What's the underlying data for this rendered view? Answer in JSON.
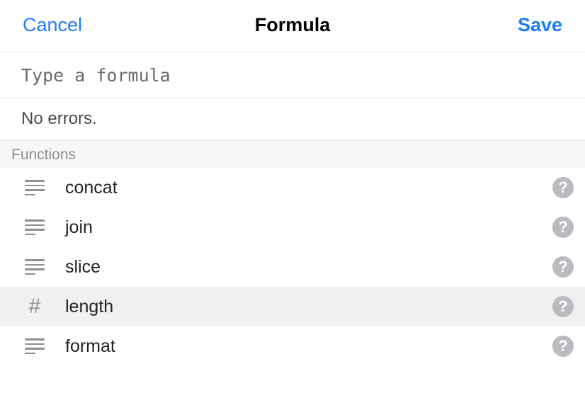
{
  "header": {
    "cancel_label": "Cancel",
    "title": "Formula",
    "save_label": "Save"
  },
  "editor": {
    "placeholder": "Type a formula",
    "value": "",
    "status_text": "No errors."
  },
  "section_title": "Functions",
  "functions": [
    {
      "name": "concat",
      "type_icon": "text",
      "highlighted": false
    },
    {
      "name": "join",
      "type_icon": "text",
      "highlighted": false
    },
    {
      "name": "slice",
      "type_icon": "text",
      "highlighted": false
    },
    {
      "name": "length",
      "type_icon": "number",
      "highlighted": true
    },
    {
      "name": "format",
      "type_icon": "text",
      "highlighted": false
    }
  ],
  "help_glyph": "?"
}
